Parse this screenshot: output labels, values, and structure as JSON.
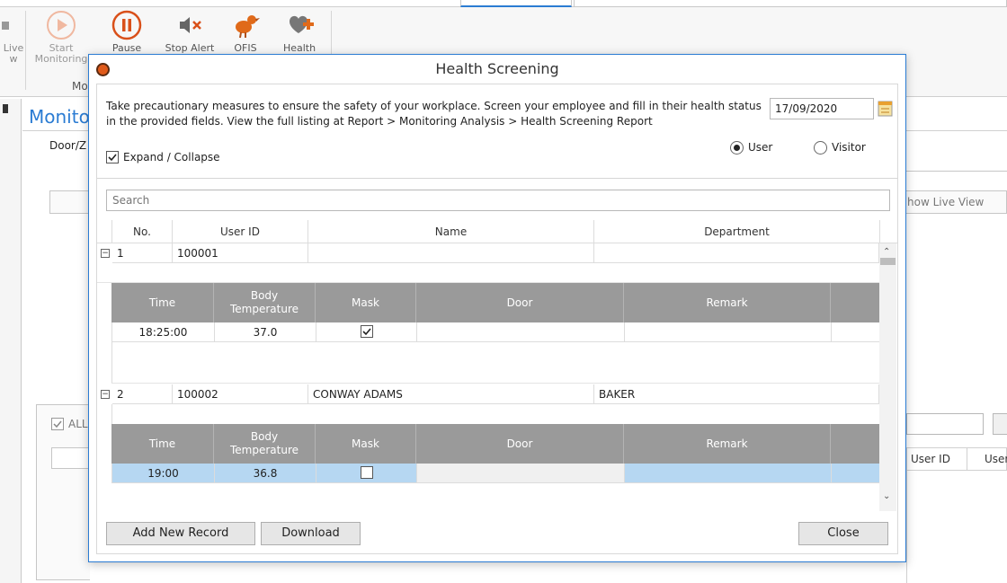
{
  "ribbon": {
    "live_view_label": "Live\nw",
    "start_monitoring_label": "Start\nMonitoring",
    "pause_label": "Pause",
    "stop_alert_label": "Stop Alert",
    "ofis_label": "OFIS",
    "health_label": "Health",
    "group_label": "Mo"
  },
  "background": {
    "monitor_title": "Monitor",
    "door_zone_label": "Door/Z",
    "show_live_view_label": "how Live View",
    "all_checkbox_label": "ALL",
    "col_user_id": "User ID",
    "col_user": "User"
  },
  "dialog": {
    "title": "Health Screening",
    "info_text": "Take precautionary measures to ensure the safety of your workplace. Screen your employee and fill in their health status in the provided fields. View the full listing at Report > Monitoring Analysis > Health Screening Report",
    "date": "17/09/2020",
    "expand_label": "Expand / Collapse",
    "radio_user_label": "User",
    "radio_visitor_label": "Visitor",
    "selected_radio": "User",
    "search_placeholder": "Search",
    "master_columns": [
      "No.",
      "User ID",
      "Name",
      "Department"
    ],
    "detail_columns": [
      "Time",
      "Body\nTemperature",
      "Mask",
      "Door",
      "Remark"
    ],
    "records": [
      {
        "no": "1",
        "user_id": "100001",
        "name": "",
        "department": "",
        "details": [
          {
            "time": "18:25:00",
            "temperature": "37.0",
            "mask": true,
            "door": "",
            "remark": ""
          }
        ]
      },
      {
        "no": "2",
        "user_id": "100002",
        "name": "CONWAY ADAMS",
        "department": "BAKER",
        "details": [
          {
            "time": "19:00",
            "temperature": "36.8",
            "mask": false,
            "door": "",
            "remark": ""
          }
        ]
      }
    ],
    "add_button": "Add New Record",
    "download_button": "Download",
    "close_button": "Close"
  }
}
